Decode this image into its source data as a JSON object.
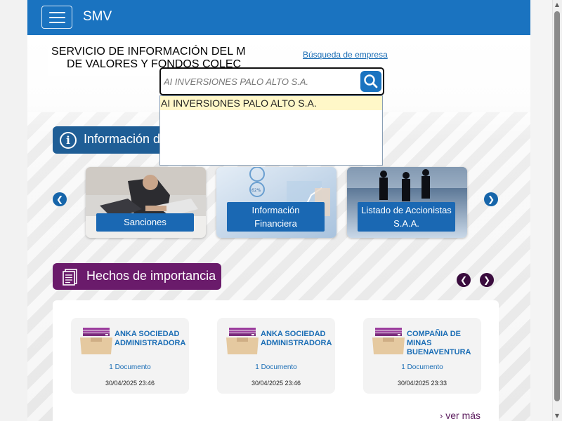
{
  "navbar": {
    "brand": "SMV"
  },
  "header": {
    "title_line1": "SERVICIO DE INFORMACIÓN DEL M",
    "title_line2": "DE VALORES Y FONDOS COLEC",
    "busqueda_link": "Búsqueda de empresa"
  },
  "search": {
    "value": "AI INVERSIONES PALO ALTO S.A.",
    "suggestion": "AI INVERSIONES PALO ALTO S.A."
  },
  "info_section": {
    "title": "Información de"
  },
  "cards": [
    {
      "label": "Sanciones"
    },
    {
      "label_line1": "Información",
      "label_line2": "Financiera"
    },
    {
      "label_line1": "Listado de Accionistas",
      "label_line2": "S.A.A."
    }
  ],
  "hechos": {
    "title": "Hechos de importancia",
    "items": [
      {
        "name": "ANKA SOCIEDAD ADMINISTRADORA",
        "docs": "1 Documento",
        "date": "30/04/2025 23:46"
      },
      {
        "name": "ANKA SOCIEDAD ADMINISTRADORA",
        "docs": "1 Documento",
        "date": "30/04/2025 23:46"
      },
      {
        "name": "COMPAÑIA DE MINAS BUENAVENTURA",
        "docs": "1 Documento",
        "date": "30/04/2025 23:33"
      }
    ],
    "ver_mas": "ver más"
  },
  "colors": {
    "navbar": "#1a73c0",
    "info_pill": "#1f5e96",
    "hechos_pill": "#6a1b6b",
    "link": "#1a6db5"
  },
  "icons": [
    "menu-icon",
    "search-icon",
    "info-icon",
    "chevron-left-icon",
    "chevron-right-icon",
    "document-icon",
    "folder-icon"
  ]
}
